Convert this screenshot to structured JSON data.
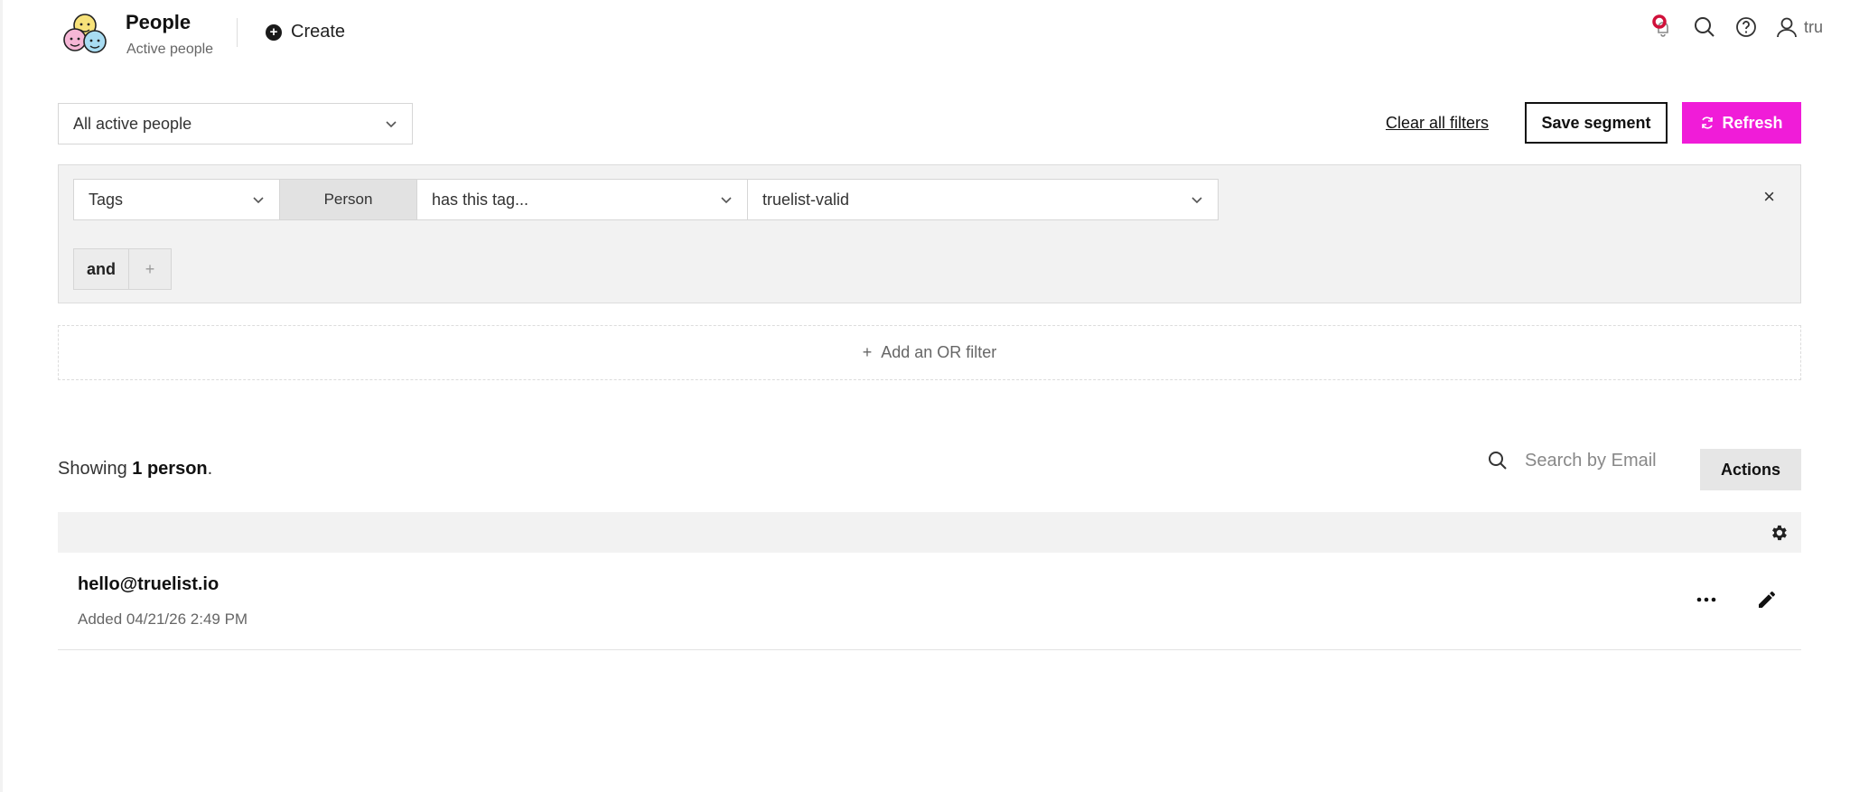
{
  "header": {
    "title": "People",
    "subtitle": "Active people",
    "create_label": "Create",
    "user_label": "tru",
    "icons": [
      "notification-bell-icon",
      "search-icon",
      "help-icon",
      "user-icon"
    ],
    "notification_color": "#d0103a"
  },
  "segment": {
    "selected": "All active people",
    "clear_filters_label": "Clear all filters",
    "save_segment_label": "Save segment",
    "refresh_label": "Refresh",
    "accent_color": "#f01cd8"
  },
  "filter": {
    "field": "Tags",
    "scope": "Person",
    "condition": "has this tag...",
    "value": "truelist-valid",
    "remove_label": "×",
    "and_label": "and",
    "plus_label": "+"
  },
  "or_filter": {
    "plus": "+",
    "label": "Add an OR filter"
  },
  "results": {
    "showing_prefix": "Showing",
    "showing_count": "1 person",
    "showing_suffix": ".",
    "search_placeholder": "Search by Email",
    "actions_label": "Actions",
    "rows": [
      {
        "email": "hello@truelist.io",
        "added": "Added 04/21/26 2:49 PM"
      }
    ]
  }
}
